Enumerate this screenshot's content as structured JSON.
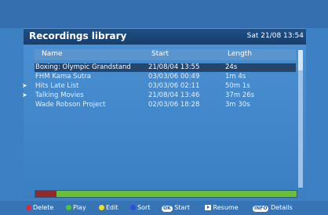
{
  "header": {
    "title": "Recordings library",
    "datetime": "Sat 21/08 13:54"
  },
  "columns": {
    "name": "Name",
    "start": "Start",
    "length": "Length"
  },
  "recordings": [
    {
      "name": "Boxing: Olympic Grandstand",
      "start": "21/08/04  13:55",
      "length": "24s",
      "selected": true,
      "marker": ""
    },
    {
      "name": "FHM Kama Sutra",
      "start": "03/03/06  00:49",
      "length": "1m 4s",
      "selected": false,
      "marker": ""
    },
    {
      "name": "Hits Late List",
      "start": "03/03/06  02:11",
      "length": "50m 1s",
      "selected": false,
      "marker": "➤"
    },
    {
      "name": "Talking Movies",
      "start": "21/08/04  13:46",
      "length": "37m 26s",
      "selected": false,
      "marker": "➤"
    },
    {
      "name": "Wade Robson Project",
      "start": "02/03/06  18:28",
      "length": "3m 30s",
      "selected": false,
      "marker": ""
    }
  ],
  "storage": {
    "used_fraction": 0.08
  },
  "footer": {
    "delete": "Delete",
    "play": "Play",
    "edit": "Edit",
    "sort": "Sort",
    "ok_key": "OK",
    "start": "Start",
    "resume": "Resume",
    "info_key": "INFO",
    "details": "Details"
  },
  "colors": {
    "red": "#e0263c",
    "green": "#4fc43a",
    "yellow": "#f2de2a",
    "blue": "#2f4fd8"
  }
}
